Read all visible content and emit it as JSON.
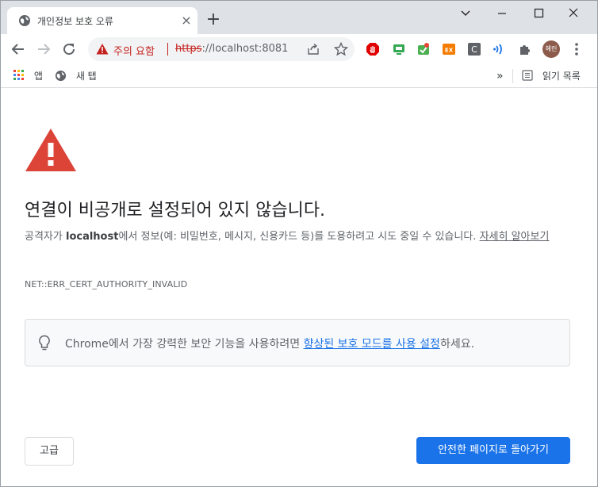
{
  "tab": {
    "title": "개인정보 보호 오류",
    "close": "×"
  },
  "newtab": "+",
  "window_controls": {
    "minimize": "⌄",
    "restore": "☐",
    "close": "✕",
    "dropdown": "—"
  },
  "omnibox": {
    "warning_label": "주의 요함",
    "url_scheme": "https",
    "url_sep": "://",
    "url_host": "localhost:8081"
  },
  "profile": {
    "initials": "혜린"
  },
  "bookmarks": {
    "apps": "앱",
    "newtab": "새 탭",
    "more": "»",
    "reading_list": "읽기 목록"
  },
  "page": {
    "heading": "연결이 비공개로 설정되어 있지 않습니다.",
    "para_prefix": "공격자가 ",
    "para_host": "localhost",
    "para_middle": "에서 정보(예: 비밀번호, 메시지, 신용카드 등)를 도용하려고 시도 중일 수 있습니다. ",
    "para_link": "자세히 알아보기",
    "error_code": "NET::ERR_CERT_AUTHORITY_INVALID",
    "tip_prefix": "Chrome에서 가장 강력한 보안 기능을 사용하려면 ",
    "tip_link": "향상된 보호 모드를 사용 설정",
    "tip_suffix": "하세요.",
    "advanced_button": "고급",
    "back_button": "안전한 페이지로 돌아가기"
  },
  "colors": {
    "accent": "#1a73e8",
    "danger": "#c5221f",
    "warning_icon": "#db4437",
    "tabstrip": "#dee1e6"
  }
}
